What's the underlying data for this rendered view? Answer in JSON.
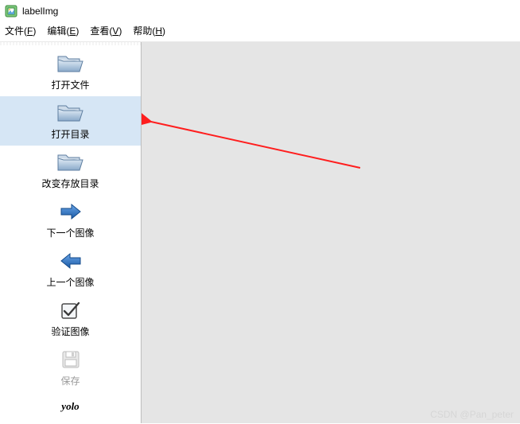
{
  "window": {
    "title": "labelImg"
  },
  "menubar": {
    "file": {
      "label": "文件(",
      "accel": "F",
      "suffix": ")"
    },
    "edit": {
      "label": "编辑(",
      "accel": "E",
      "suffix": ")"
    },
    "view": {
      "label": "查看(",
      "accel": "V",
      "suffix": ")"
    },
    "help": {
      "label": "帮助(",
      "accel": "H",
      "suffix": ")"
    }
  },
  "toolbar": {
    "open_file": "打开文件",
    "open_dir": "打开目录",
    "change_save_dir": "改变存放目录",
    "next_image": "下一个图像",
    "prev_image": "上一个图像",
    "verify_image": "验证图像",
    "save": "保存",
    "yolo": "yolo"
  },
  "watermark": "CSDN @Pan_peter"
}
